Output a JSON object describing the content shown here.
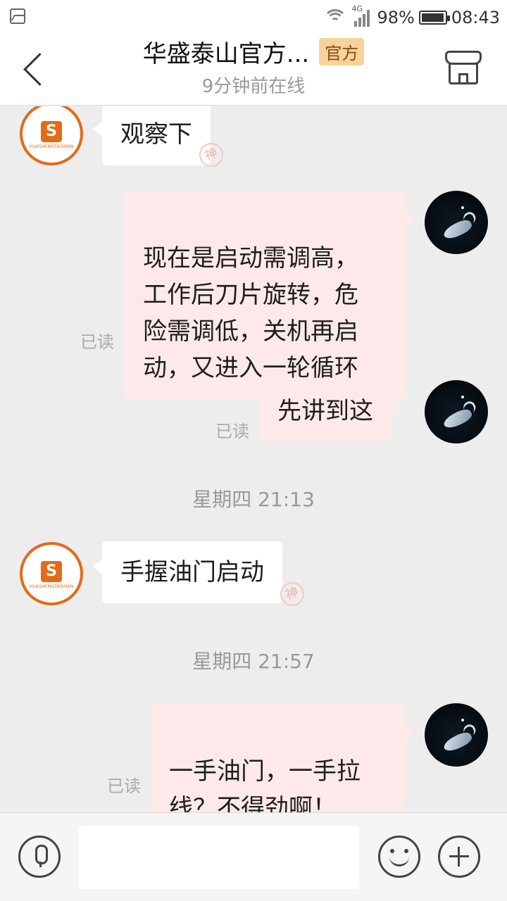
{
  "status_bar": {
    "network": "4G",
    "battery": "98%",
    "time": "08:43"
  },
  "header": {
    "title": "华盛泰山官方...",
    "badge": "官方",
    "subtitle": "9分钟前在线"
  },
  "shop_avatar": {
    "logo_letter": "S",
    "logo_text": "HUASHENGTAISHAN"
  },
  "messages": [
    {
      "from": "shop",
      "text": "观察下",
      "stamp": "神"
    },
    {
      "from": "user",
      "text": "现在是启动需调高，\n工作后刀片旋转，危\n险需调低，关机再启\n动，又进入一轮循环",
      "read": "已读"
    },
    {
      "from": "user",
      "text": "先讲到这",
      "read": "已读"
    },
    {
      "from": "shop",
      "text": "手握油门启动",
      "stamp": "神"
    },
    {
      "from": "user",
      "text": "一手油门，一手拉\n线？不得劲啊！",
      "read": "已读"
    }
  ],
  "timestamps": [
    "星期四 21:13",
    "星期四 21:57"
  ],
  "input": {
    "placeholder": ""
  },
  "colors": {
    "accent": "#e36b18",
    "badge_bg": "#f7d39b",
    "outgoing_bubble": "#fde9e9",
    "chat_bg": "#ededed"
  }
}
